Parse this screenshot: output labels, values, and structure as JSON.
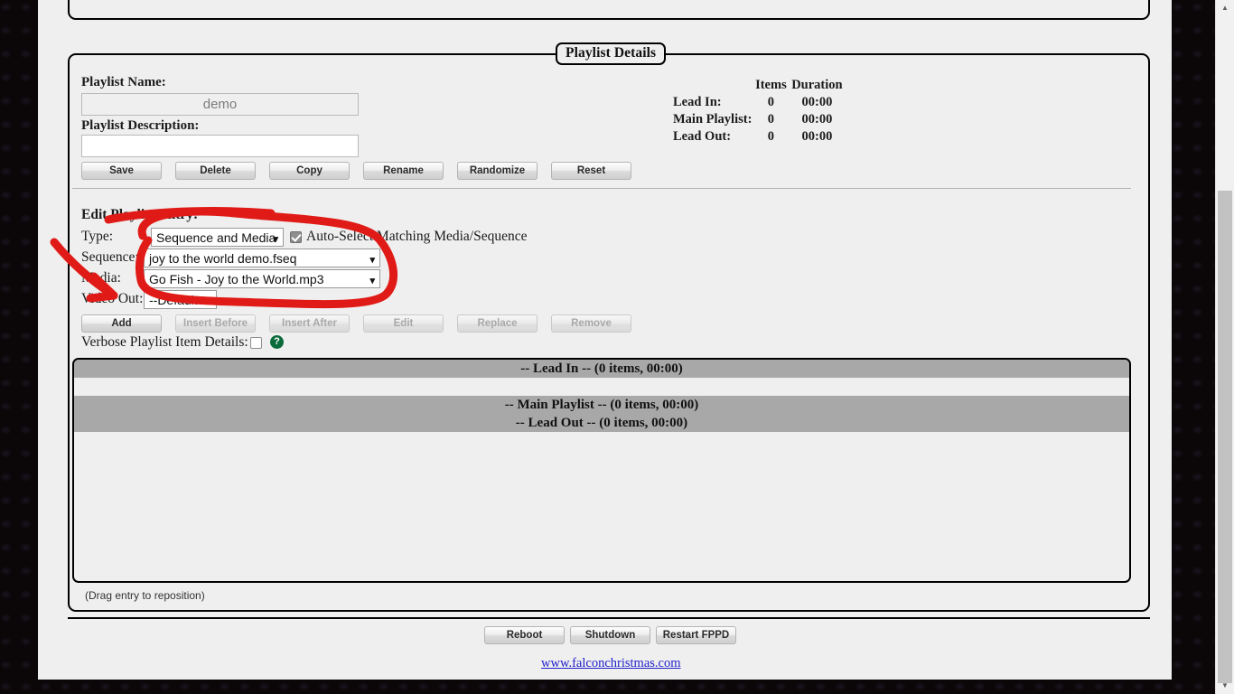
{
  "panel": {
    "legend": "Playlist Details",
    "playlist_name_label": "Playlist Name:",
    "playlist_name_value": "demo",
    "playlist_description_label": "Playlist Description:",
    "playlist_description_value": "",
    "playlist_description_placeholder": ""
  },
  "summary": {
    "col_items": "Items",
    "col_duration": "Duration",
    "rows": [
      {
        "label": "Lead In:",
        "items": "0",
        "duration": "00:00"
      },
      {
        "label": "Main Playlist:",
        "items": "0",
        "duration": "00:00"
      },
      {
        "label": "Lead Out:",
        "items": "0",
        "duration": "00:00"
      }
    ]
  },
  "playlist_buttons": [
    {
      "label": "Save",
      "disabled": false
    },
    {
      "label": "Delete",
      "disabled": false
    },
    {
      "label": "Copy",
      "disabled": false
    },
    {
      "label": "Rename",
      "disabled": false
    },
    {
      "label": "Randomize",
      "disabled": false
    },
    {
      "label": "Reset",
      "disabled": false
    }
  ],
  "edit_entry": {
    "heading": "Edit Playlist Entry:",
    "type_label": "Type:",
    "type_value": "Sequence and Media",
    "autoselect_label": "Auto-Select Matching Media/Sequence",
    "autoselect_checked": true,
    "sequence_label": "Sequence:",
    "sequence_value": "joy to the world demo.fseq",
    "media_label": "Media:",
    "media_value": "Go Fish - Joy to the World.mp3",
    "videoout_label": "Video Out:",
    "videoout_value": "--Default--",
    "verbose_label": "Verbose Playlist Item Details:",
    "verbose_checked": false,
    "help_glyph": "?"
  },
  "entry_buttons": [
    {
      "label": "Add",
      "disabled": false
    },
    {
      "label": "Insert Before",
      "disabled": true
    },
    {
      "label": "Insert After",
      "disabled": true
    },
    {
      "label": "Edit",
      "disabled": true
    },
    {
      "label": "Replace",
      "disabled": true
    },
    {
      "label": "Remove",
      "disabled": true
    }
  ],
  "playlist_rows": [
    {
      "text": "-- Lead In -- (0 items,  00:00)",
      "kind": "hdr"
    },
    {
      "text": "",
      "kind": "gap"
    },
    {
      "text": "-- Main Playlist -- (0 items,  00:00)",
      "kind": "hdr"
    },
    {
      "text": "-- Lead Out -- (0 items,  00:00)",
      "kind": "hdr"
    }
  ],
  "drag_hint": "(Drag entry to reposition)",
  "footer": {
    "buttons": [
      {
        "label": "Reboot"
      },
      {
        "label": "Shutdown"
      },
      {
        "label": "Restart FPPD"
      }
    ],
    "link": "www.falconchristmas.com"
  },
  "scrollbar": {
    "up_glyph": "▲",
    "down_glyph": "▼"
  },
  "annotation": {
    "color": "#e01b17",
    "shapes": "circle-around-sequence-media-selects, arrow-pointing-right-down"
  }
}
